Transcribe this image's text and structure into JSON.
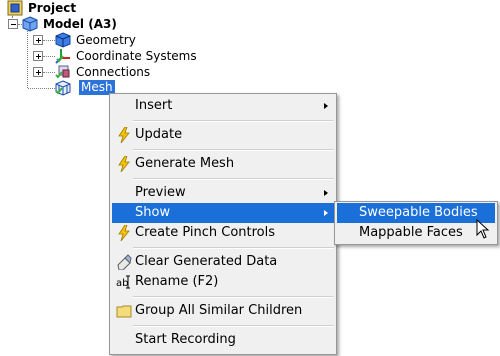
{
  "tree": {
    "project_label": "Project",
    "model_label": "Model (A3)",
    "children": [
      {
        "label": "Geometry"
      },
      {
        "label": "Coordinate Systems"
      },
      {
        "label": "Connections"
      },
      {
        "label": "Mesh"
      }
    ]
  },
  "context_menu": {
    "items": {
      "insert": "Insert",
      "update": "Update",
      "generate_mesh": "Generate Mesh",
      "preview": "Preview",
      "show": "Show",
      "create_pinch_controls": "Create Pinch Controls",
      "clear_generated_data": "Clear Generated Data",
      "rename": "Rename (F2)",
      "group_all_similar_children": "Group All Similar Children",
      "start_recording": "Start Recording"
    }
  },
  "submenu": {
    "items": {
      "sweepable_bodies": "Sweepable Bodies",
      "mappable_faces": "Mappable Faces"
    }
  },
  "colors": {
    "highlight": "#1a6fd9",
    "menu_background": "#f0f0f0",
    "lightning": "#f5c400",
    "check": "#3cb043"
  },
  "icons": {
    "project": "project-icon",
    "model": "model-cube-icon",
    "geometry": "geometry-icon",
    "coordinate_systems": "coordinate-axes-icon",
    "connections": "connections-icon",
    "mesh": "mesh-icon",
    "update": "lightning-icon",
    "generate_mesh": "lightning-icon",
    "create_pinch_controls": "lightning-icon",
    "clear_generated_data": "eraser-icon",
    "rename": "rename-icon",
    "group": "folder-icon",
    "cursor": "mouse-cursor-icon"
  }
}
